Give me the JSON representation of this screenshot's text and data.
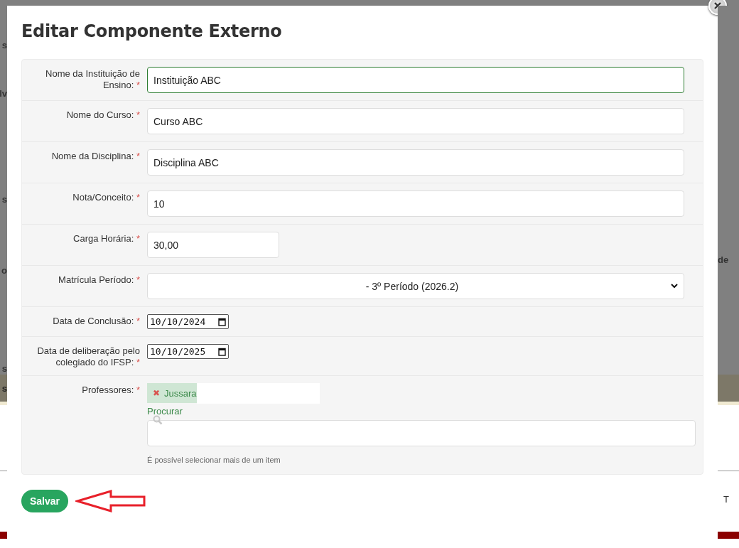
{
  "backdrop": {
    "left_fragments": [
      "s",
      "lv",
      "s",
      "o",
      "s",
      "s"
    ],
    "right_fragments": [
      "de",
      "T"
    ]
  },
  "dialog": {
    "title": "Editar Componente Externo",
    "fields": [
      {
        "kind": "text",
        "label": "Nome da Instituição de Ensino:",
        "required_mark": "*",
        "value": "Instituição ABC",
        "focused": true
      },
      {
        "kind": "text",
        "label": "Nome do Curso:",
        "required_mark": "*",
        "value": "Curso ABC",
        "focused": false
      },
      {
        "kind": "text",
        "label": "Nome da Disciplina:",
        "required_mark": "*",
        "value": "Disciplina ABC",
        "focused": false
      },
      {
        "kind": "text",
        "label": "Nota/Conceito:",
        "required_mark": "*",
        "value": "10",
        "focused": false
      },
      {
        "kind": "short",
        "label": "Carga Horária:",
        "required_mark": "*",
        "value": "30,00",
        "focused": false
      },
      {
        "kind": "select",
        "label": "Matrícula Período:",
        "required_mark": "*",
        "value": "- 3º Período (2026.2)"
      },
      {
        "kind": "date",
        "label": "Data de Conclusão:",
        "required_mark": "*",
        "value": "10/10/2024"
      },
      {
        "kind": "date",
        "label": "Data de deliberação pelo colegiado do IFSP:",
        "required_mark": "*",
        "value": "10/10/2025"
      },
      {
        "kind": "multiselect",
        "label": "Professores:",
        "required_mark": "*",
        "chips": [
          {
            "remove": "✖",
            "label": "Jussara"
          }
        ],
        "search_label": "Procurar",
        "hint": "É possível selecionar mais de um item"
      }
    ],
    "save_button": "Salvar"
  }
}
